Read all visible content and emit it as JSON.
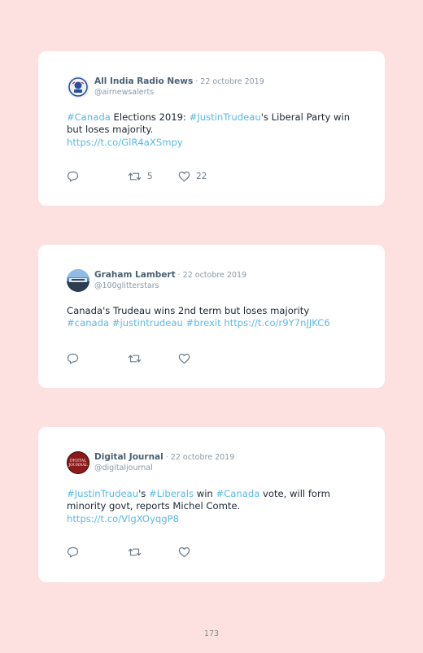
{
  "tweets": [
    {
      "author": "All India Radio News",
      "date": " · 22 octobre 2019",
      "handle": "@airnewsalerts",
      "avatar_icon": "air-emblem-icon",
      "segments": [
        {
          "text": "#Canada",
          "link": true
        },
        {
          "text": " Elections 2019: ",
          "link": false
        },
        {
          "text": "#JustinTrudeau",
          "link": true
        },
        {
          "text": "'s Liberal Party win but loses majority.",
          "link": false
        },
        {
          "text": "https://t.co/GlR4aXSmpy",
          "link": true,
          "newline": true
        }
      ],
      "retweets": "5",
      "likes": "22"
    },
    {
      "author": "Graham Lambert",
      "date": " · 22 octobre 2019",
      "handle": "@100glitterstars",
      "avatar_icon": "sky-photo-avatar",
      "segments": [
        {
          "text": "Canada's Trudeau wins 2nd term but loses majority",
          "link": false
        },
        {
          "text": "#canada #justintrudeau #brexit https://t.co/r9Y7nJJKC6",
          "link": true,
          "newline": true
        }
      ],
      "retweets": "",
      "likes": ""
    },
    {
      "author": "Digital Journal",
      "date": " · 22 octobre 2019",
      "handle": "@digitaljournal",
      "avatar_icon": "digital-journal-logo",
      "avatar_text": "DIGITAL JOURNAL",
      "segments": [
        {
          "text": "#JustinTrudeau",
          "link": true
        },
        {
          "text": "'s ",
          "link": false
        },
        {
          "text": "#Liberals",
          "link": true
        },
        {
          "text": " win ",
          "link": false
        },
        {
          "text": "#Canada",
          "link": true
        },
        {
          "text": " vote, will form minority govt, reports Michel Comte.",
          "link": false
        },
        {
          "text": "https://t.co/VlgXOyqgP8",
          "link": true,
          "newline": true
        }
      ],
      "retweets": "",
      "likes": ""
    }
  ],
  "page_number": "173",
  "colors": {
    "background": "#fde1e1",
    "card": "#ffffff",
    "link": "#5bb8e8",
    "name": "#4a6074",
    "muted": "#8899a6"
  }
}
